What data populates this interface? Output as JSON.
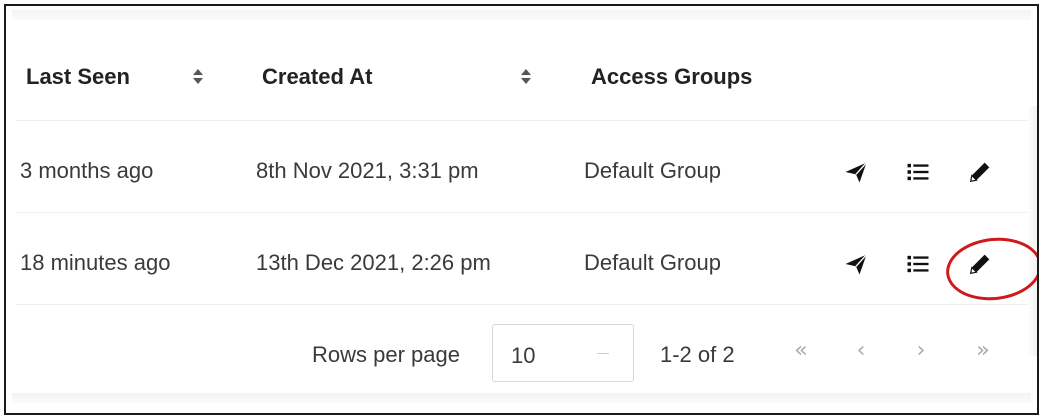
{
  "table": {
    "headers": {
      "last_seen": "Last Seen",
      "created_at": "Created At",
      "access_groups": "Access Groups"
    },
    "rows": [
      {
        "last_seen": "3 months ago",
        "created_at": "8th Nov 2021, 3:31 pm",
        "access_groups": "Default Group"
      },
      {
        "last_seen": "18 minutes ago",
        "created_at": "13th Dec 2021, 2:26 pm",
        "access_groups": "Default Group"
      }
    ],
    "row_actions": [
      "send-icon",
      "list-icon",
      "pencil-icon"
    ]
  },
  "pagination": {
    "rows_per_page_label": "Rows per page",
    "rows_per_page_value": "10",
    "range_label": "1-2 of 2",
    "first_page_glyph": "«",
    "prev_page_glyph": "‹",
    "next_page_glyph": "›",
    "last_page_glyph": "»"
  },
  "annotation": {
    "color": "#d0191c",
    "target": "row-2 edit pencil"
  }
}
